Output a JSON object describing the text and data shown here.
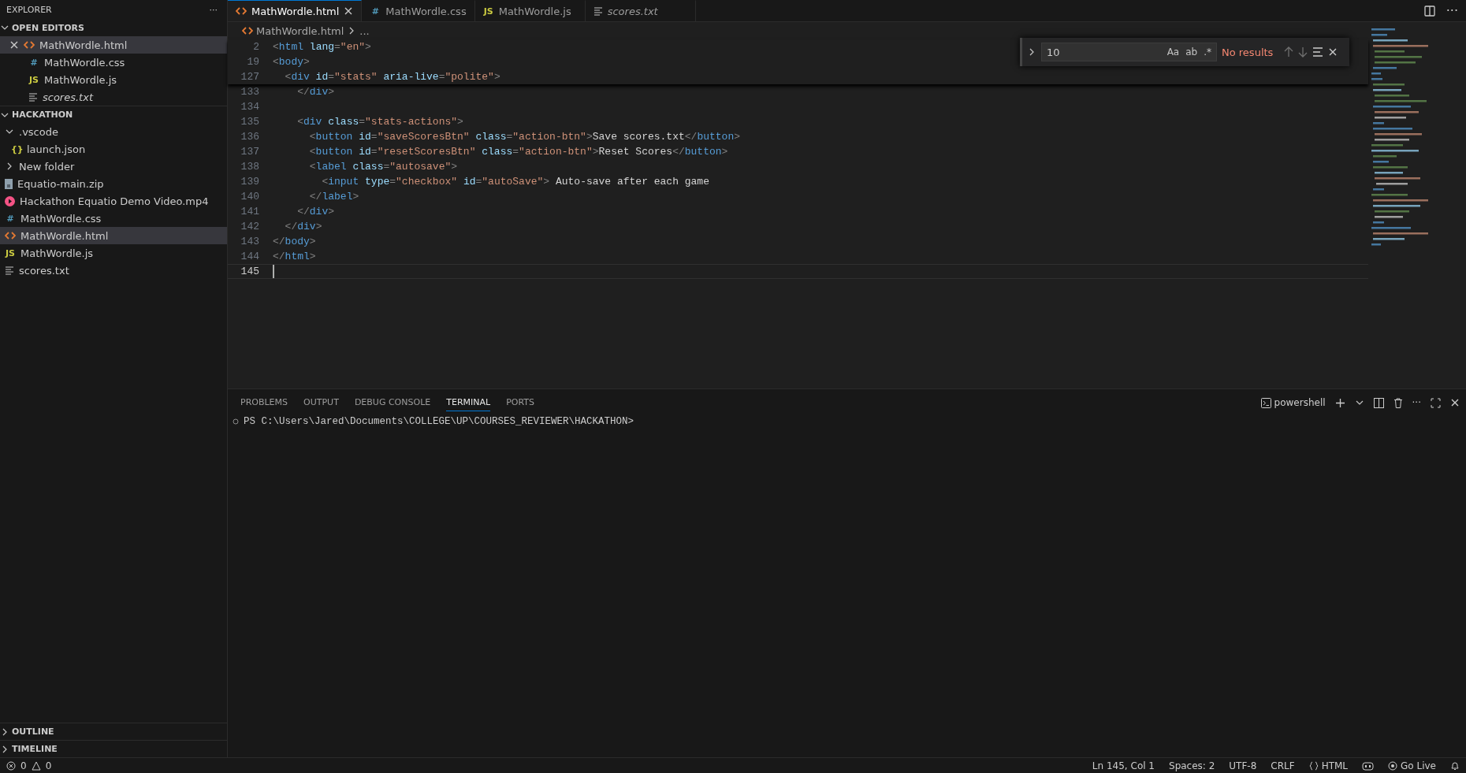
{
  "explorer": {
    "title": "EXPLORER",
    "more": "···",
    "open_editors": {
      "title": "OPEN EDITORS",
      "expanded": true,
      "items": [
        {
          "name": "MathWordle.html",
          "kind": "html",
          "selected": true,
          "preview": false
        },
        {
          "name": "MathWordle.css",
          "kind": "css",
          "glyph": "#",
          "selected": false,
          "preview": false
        },
        {
          "name": "MathWordle.js",
          "kind": "js",
          "glyph": "JS",
          "selected": false,
          "preview": false
        },
        {
          "name": "scores.txt",
          "kind": "txt",
          "selected": false,
          "preview": true
        }
      ]
    },
    "folder": {
      "title": "HACKATHON",
      "expanded": true,
      "items": [
        {
          "name": ".vscode",
          "kind": "folder",
          "expanded": true,
          "selected": false,
          "children": [
            {
              "name": "launch.json",
              "kind": "json",
              "glyph": "{}",
              "selected": false
            }
          ]
        },
        {
          "name": "New folder",
          "kind": "folder",
          "expanded": false,
          "selected": false
        },
        {
          "name": "Equatio-main.zip",
          "kind": "zip",
          "selected": false
        },
        {
          "name": "Hackathon Equatio Demo Video.mp4",
          "kind": "video",
          "selected": false
        },
        {
          "name": "MathWordle.css",
          "kind": "css",
          "glyph": "#",
          "selected": false
        },
        {
          "name": "MathWordle.html",
          "kind": "html",
          "selected": true
        },
        {
          "name": "MathWordle.js",
          "kind": "js",
          "glyph": "JS",
          "selected": false
        },
        {
          "name": "scores.txt",
          "kind": "txt",
          "selected": false
        }
      ]
    },
    "bottom_sections": [
      {
        "title": "OUTLINE",
        "expanded": false
      },
      {
        "title": "TIMELINE",
        "expanded": false
      }
    ]
  },
  "tabs": [
    {
      "name": "MathWordle.html",
      "kind": "html",
      "selected": true,
      "preview": false
    },
    {
      "name": "MathWordle.css",
      "kind": "css",
      "glyph": "#",
      "selected": false,
      "preview": false
    },
    {
      "name": "MathWordle.js",
      "kind": "js",
      "glyph": "JS",
      "selected": false,
      "preview": false
    },
    {
      "name": "scores.txt",
      "kind": "txt",
      "selected": false,
      "preview": true
    }
  ],
  "editor_actions": {
    "more": "···"
  },
  "breadcrumb": {
    "file": "MathWordle.html",
    "rest": "..."
  },
  "sticky_lines": [
    {
      "number": "2",
      "tokens": [
        {
          "kind": "p",
          "text": "<"
        },
        {
          "kind": "t",
          "text": "html"
        },
        {
          "kind": "a",
          "text": " lang"
        },
        {
          "kind": "p",
          "text": "="
        },
        {
          "kind": "s",
          "text": "\"en\""
        },
        {
          "kind": "p",
          "text": ">"
        }
      ]
    },
    {
      "number": "19",
      "tokens": [
        {
          "kind": "p",
          "text": "<"
        },
        {
          "kind": "t",
          "text": "body"
        },
        {
          "kind": "p",
          "text": ">"
        }
      ]
    },
    {
      "number": "127",
      "tokens": [
        {
          "kind": "p",
          "text": "  <"
        },
        {
          "kind": "t",
          "text": "div"
        },
        {
          "kind": "a",
          "text": " id"
        },
        {
          "kind": "p",
          "text": "="
        },
        {
          "kind": "s",
          "text": "\"stats\""
        },
        {
          "kind": "a",
          "text": " aria-live"
        },
        {
          "kind": "p",
          "text": "="
        },
        {
          "kind": "s",
          "text": "\"polite\""
        },
        {
          "kind": "p",
          "text": ">"
        }
      ]
    }
  ],
  "lines": [
    {
      "number": "133",
      "current": false,
      "tokens": [
        {
          "kind": "p",
          "text": "    </"
        },
        {
          "kind": "t",
          "text": "div"
        },
        {
          "kind": "p",
          "text": ">"
        }
      ]
    },
    {
      "number": "134",
      "current": false
    },
    {
      "number": "135",
      "current": false,
      "tokens": [
        {
          "kind": "p",
          "text": "    <"
        },
        {
          "kind": "t",
          "text": "div"
        },
        {
          "kind": "a",
          "text": " class"
        },
        {
          "kind": "p",
          "text": "="
        },
        {
          "kind": "s",
          "text": "\"stats-actions\""
        },
        {
          "kind": "p",
          "text": ">"
        }
      ]
    },
    {
      "number": "136",
      "current": false,
      "tokens": [
        {
          "kind": "p",
          "text": "      <"
        },
        {
          "kind": "t",
          "text": "button"
        },
        {
          "kind": "a",
          "text": " id"
        },
        {
          "kind": "p",
          "text": "="
        },
        {
          "kind": "s",
          "text": "\"saveScoresBtn\""
        },
        {
          "kind": "a",
          "text": " class"
        },
        {
          "kind": "p",
          "text": "="
        },
        {
          "kind": "s",
          "text": "\"action-btn\""
        },
        {
          "kind": "p",
          "text": ">"
        },
        {
          "kind": "x",
          "text": "Save scores.txt"
        },
        {
          "kind": "p",
          "text": "</"
        },
        {
          "kind": "t",
          "text": "button"
        },
        {
          "kind": "p",
          "text": ">"
        }
      ]
    },
    {
      "number": "137",
      "current": false,
      "tokens": [
        {
          "kind": "p",
          "text": "      <"
        },
        {
          "kind": "t",
          "text": "button"
        },
        {
          "kind": "a",
          "text": " id"
        },
        {
          "kind": "p",
          "text": "="
        },
        {
          "kind": "s",
          "text": "\"resetScoresBtn\""
        },
        {
          "kind": "a",
          "text": " class"
        },
        {
          "kind": "p",
          "text": "="
        },
        {
          "kind": "s",
          "text": "\"action-btn\""
        },
        {
          "kind": "p",
          "text": ">"
        },
        {
          "kind": "x",
          "text": "Reset Scores"
        },
        {
          "kind": "p",
          "text": "</"
        },
        {
          "kind": "t",
          "text": "button"
        },
        {
          "kind": "p",
          "text": ">"
        }
      ]
    },
    {
      "number": "138",
      "current": false,
      "tokens": [
        {
          "kind": "p",
          "text": "      <"
        },
        {
          "kind": "t",
          "text": "label"
        },
        {
          "kind": "a",
          "text": " class"
        },
        {
          "kind": "p",
          "text": "="
        },
        {
          "kind": "s",
          "text": "\"autosave\""
        },
        {
          "kind": "p",
          "text": ">"
        }
      ]
    },
    {
      "number": "139",
      "current": false,
      "tokens": [
        {
          "kind": "p",
          "text": "        <"
        },
        {
          "kind": "t",
          "text": "input"
        },
        {
          "kind": "a",
          "text": " type"
        },
        {
          "kind": "p",
          "text": "="
        },
        {
          "kind": "s",
          "text": "\"checkbox\""
        },
        {
          "kind": "a",
          "text": " id"
        },
        {
          "kind": "p",
          "text": "="
        },
        {
          "kind": "s",
          "text": "\"autoSave\""
        },
        {
          "kind": "p",
          "text": ">"
        },
        {
          "kind": "x",
          "text": " Auto-save after each game"
        }
      ]
    },
    {
      "number": "140",
      "current": false,
      "tokens": [
        {
          "kind": "p",
          "text": "      </"
        },
        {
          "kind": "t",
          "text": "label"
        },
        {
          "kind": "p",
          "text": ">"
        }
      ]
    },
    {
      "number": "141",
      "current": false,
      "tokens": [
        {
          "kind": "p",
          "text": "    </"
        },
        {
          "kind": "t",
          "text": "div"
        },
        {
          "kind": "p",
          "text": ">"
        }
      ]
    },
    {
      "number": "142",
      "current": false,
      "tokens": [
        {
          "kind": "p",
          "text": "  </"
        },
        {
          "kind": "t",
          "text": "div"
        },
        {
          "kind": "p",
          "text": ">"
        }
      ]
    },
    {
      "number": "143",
      "current": false,
      "tokens": [
        {
          "kind": "p",
          "text": "</"
        },
        {
          "kind": "t",
          "text": "body"
        },
        {
          "kind": "p",
          "text": ">"
        }
      ]
    },
    {
      "number": "144",
      "current": false,
      "tokens": [
        {
          "kind": "p",
          "text": "</"
        },
        {
          "kind": "t",
          "text": "html"
        },
        {
          "kind": "p",
          "text": ">"
        }
      ]
    },
    {
      "number": "145",
      "current": true
    }
  ],
  "find": {
    "value": "10",
    "options": [
      "Aa",
      "ab",
      ".*"
    ],
    "message": "No results"
  },
  "panel": {
    "tabs": [
      {
        "label": "PROBLEMS",
        "selected": false
      },
      {
        "label": "OUTPUT",
        "selected": false
      },
      {
        "label": "DEBUG CONSOLE",
        "selected": false
      },
      {
        "label": "TERMINAL",
        "selected": true
      },
      {
        "label": "PORTS",
        "selected": false
      }
    ],
    "shell": "powershell",
    "more": "···",
    "prompt": "PS C:\\Users\\Jared\\Documents\\COLLEGE\\UP\\COURSES_REVIEWER\\HACKATHON>"
  },
  "status_bar": {
    "errors": "0",
    "warnings": "0",
    "right": [
      {
        "kind": "text",
        "text": "Ln 145, Col 1"
      },
      {
        "kind": "text",
        "text": "Spaces: 2"
      },
      {
        "kind": "text",
        "text": "UTF-8"
      },
      {
        "kind": "text",
        "text": "CRLF"
      },
      {
        "kind": "language",
        "text": "HTML"
      },
      {
        "kind": "copilot"
      },
      {
        "kind": "golive",
        "text": "Go Live"
      },
      {
        "kind": "bell"
      }
    ]
  }
}
